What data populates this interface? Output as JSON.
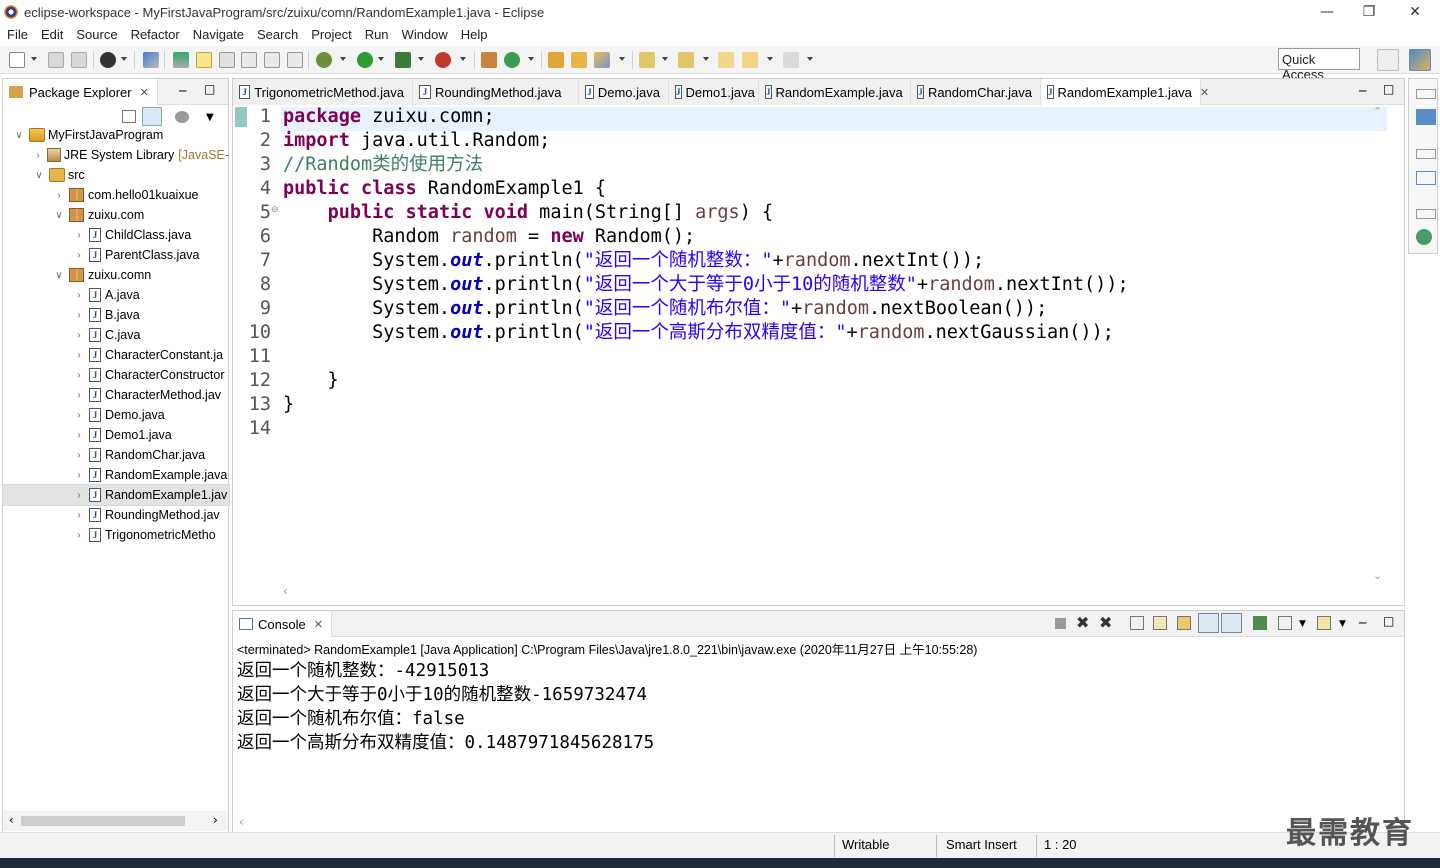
{
  "window": {
    "title": "eclipse-workspace - MyFirstJavaProgram/src/zuixu/comn/RandomExample1.java - Eclipse"
  },
  "menu": [
    "File",
    "Edit",
    "Source",
    "Refactor",
    "Navigate",
    "Search",
    "Project",
    "Run",
    "Window",
    "Help"
  ],
  "toolbar": {
    "quick_access": "Quick Access"
  },
  "package_explorer": {
    "title": "Package Explorer",
    "tree": [
      {
        "label": "MyFirstJavaProgram",
        "type": "project",
        "twisty": "open"
      },
      {
        "label": "JRE System Library",
        "suffix": "[JavaSE-",
        "type": "library",
        "twisty": "closed"
      },
      {
        "label": "src",
        "type": "src",
        "twisty": "open"
      },
      {
        "label": "com.hello01kuaixue",
        "type": "package",
        "twisty": "closed"
      },
      {
        "label": "zuixu.com",
        "type": "package",
        "twisty": "open"
      },
      {
        "label": "ChildClass.java",
        "type": "java",
        "twisty": "closed"
      },
      {
        "label": "ParentClass.java",
        "type": "java",
        "twisty": "closed"
      },
      {
        "label": "zuixu.comn",
        "type": "package",
        "twisty": "open"
      },
      {
        "label": "A.java",
        "type": "java",
        "twisty": "closed"
      },
      {
        "label": "B.java",
        "type": "java",
        "twisty": "closed"
      },
      {
        "label": "C.java",
        "type": "java",
        "twisty": "closed"
      },
      {
        "label": "CharacterConstant.ja",
        "type": "java",
        "twisty": "closed"
      },
      {
        "label": "CharacterConstructor",
        "type": "java",
        "twisty": "closed"
      },
      {
        "label": "CharacterMethod.jav",
        "type": "java",
        "twisty": "closed"
      },
      {
        "label": "Demo.java",
        "type": "java",
        "twisty": "closed"
      },
      {
        "label": "Demo1.java",
        "type": "java",
        "twisty": "closed"
      },
      {
        "label": "RandomChar.java",
        "type": "java",
        "twisty": "closed"
      },
      {
        "label": "RandomExample.java",
        "type": "java",
        "twisty": "closed"
      },
      {
        "label": "RandomExample1.jav",
        "type": "java",
        "twisty": "closed",
        "selected": true
      },
      {
        "label": "RoundingMethod.jav",
        "type": "java",
        "twisty": "closed"
      },
      {
        "label": "TrigonometricMetho",
        "type": "java",
        "twisty": "closed"
      }
    ]
  },
  "editor": {
    "tabs": [
      {
        "label": "TrigonometricMethod.java"
      },
      {
        "label": "RoundingMethod.java"
      },
      {
        "label": "Demo.java"
      },
      {
        "label": "Demo1.java"
      },
      {
        "label": "RandomExample.java"
      },
      {
        "label": "RandomChar.java"
      },
      {
        "label": "RandomExample1.java",
        "active": true
      }
    ],
    "line_numbers": [
      "1",
      "2",
      "3",
      "4",
      "5",
      "6",
      "7",
      "8",
      "9",
      "10",
      "11",
      "12",
      "13",
      "14"
    ],
    "code": {
      "l1_kw": "package",
      "l1_rest": " zuixu.comn;",
      "l2_kw": "import",
      "l2_rest": " java.util.Random;",
      "l3_comment": "//Random类的使用方法",
      "l4_kw": "public class",
      "l4_rest": " RandomExample1 {",
      "l5_kw": "public static void",
      "l5_rest": " main(String[] ",
      "l5_args": "args",
      "l5_end": ") {",
      "l6_a": "Random ",
      "l6_var": "random",
      "l6_b": " = ",
      "l6_kw": "new",
      "l6_c": " Random();",
      "sys": "System.",
      "out": "out",
      "println": ".println(",
      "l7_str": "\"返回一个随机整数：\"",
      "l7_end": ".nextInt());",
      "l8_str": "\"返回一个大于等于0小于10的随机整数\"",
      "l8_end": ".nextInt());",
      "l9_str": "\"返回一个随机布尔值：\"",
      "l9_end": ".nextBoolean());",
      "l10_str": "\"返回一个高斯分布双精度值：\"",
      "l10_end": ".nextGaussian());",
      "plus": "+",
      "random": "random",
      "l12": "    }",
      "l13": "}"
    }
  },
  "console": {
    "title": "Console",
    "terminated": "<terminated> RandomExample1 [Java Application] C:\\Program Files\\Java\\jre1.8.0_221\\bin\\javaw.exe (2020年11月27日 上午10:55:28)",
    "lines": [
      "返回一个随机整数：-42915013",
      "返回一个大于等于0小于10的随机整数-1659732474",
      "返回一个随机布尔值：false",
      "返回一个高斯分布双精度值：0.1487971845628175"
    ]
  },
  "status": {
    "writable": "Writable",
    "insert_mode": "Smart Insert",
    "position": "1 : 20"
  },
  "watermark": "最需教育"
}
